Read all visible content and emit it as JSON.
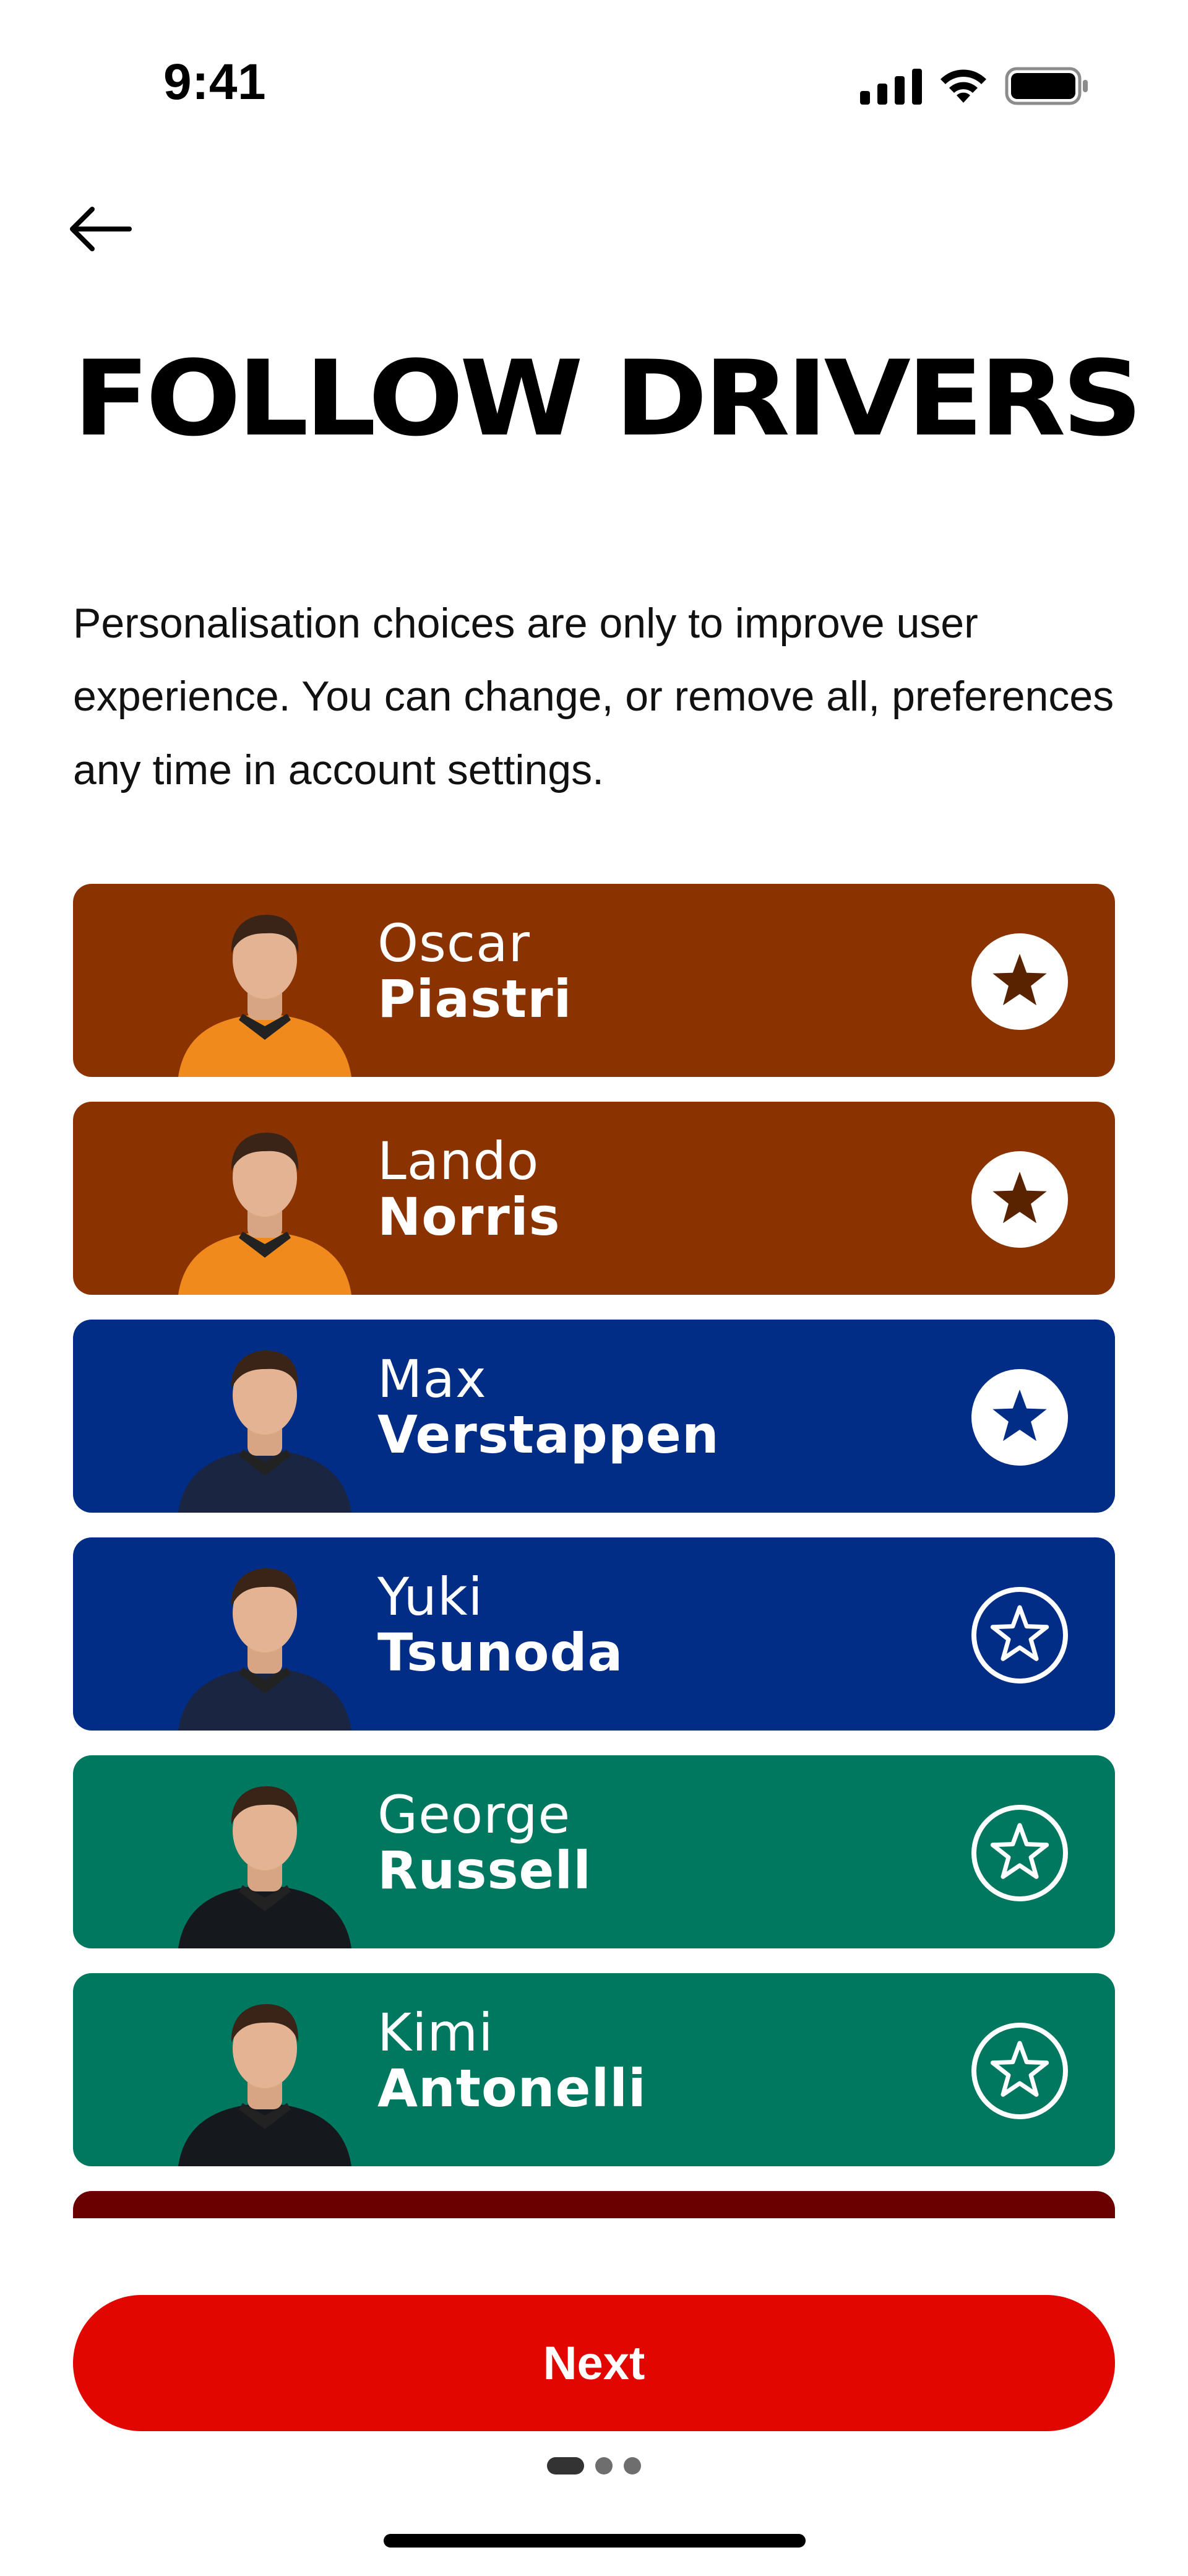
{
  "status_bar": {
    "time": "9:41"
  },
  "page_title": "FOLLOW DRIVERS",
  "intro_text": "Personalisation choices are only to improve user experience. You can change, or remove all, preferences any time in account settings.",
  "drivers": [
    {
      "first": "Oscar",
      "last": "Piastri",
      "team_color": "#8b3300",
      "suit_color": "#f08a1c",
      "selected": true,
      "star_color": "#5a2300"
    },
    {
      "first": "Lando",
      "last": "Norris",
      "team_color": "#8b3300",
      "suit_color": "#f08a1c",
      "selected": true,
      "star_color": "#5a2300"
    },
    {
      "first": "Max",
      "last": "Verstappen",
      "team_color": "#022d86",
      "suit_color": "#1a2542",
      "selected": true,
      "star_color": "#022d86"
    },
    {
      "first": "Yuki",
      "last": "Tsunoda",
      "team_color": "#022d86",
      "suit_color": "#1a2542",
      "selected": false,
      "star_color": "#ffffff"
    },
    {
      "first": "George",
      "last": "Russell",
      "team_color": "#00775f",
      "suit_color": "#15181d",
      "selected": false,
      "star_color": "#ffffff"
    },
    {
      "first": "Kimi",
      "last": "Antonelli",
      "team_color": "#00775f",
      "suit_color": "#15181d",
      "selected": false,
      "star_color": "#ffffff"
    },
    {
      "first": "",
      "last": "",
      "team_color": "#6b0000",
      "suit_color": "#6b0000",
      "selected": false,
      "star_color": "#ffffff"
    }
  ],
  "next_label": "Next",
  "pagination": {
    "current": 1,
    "total": 3
  }
}
